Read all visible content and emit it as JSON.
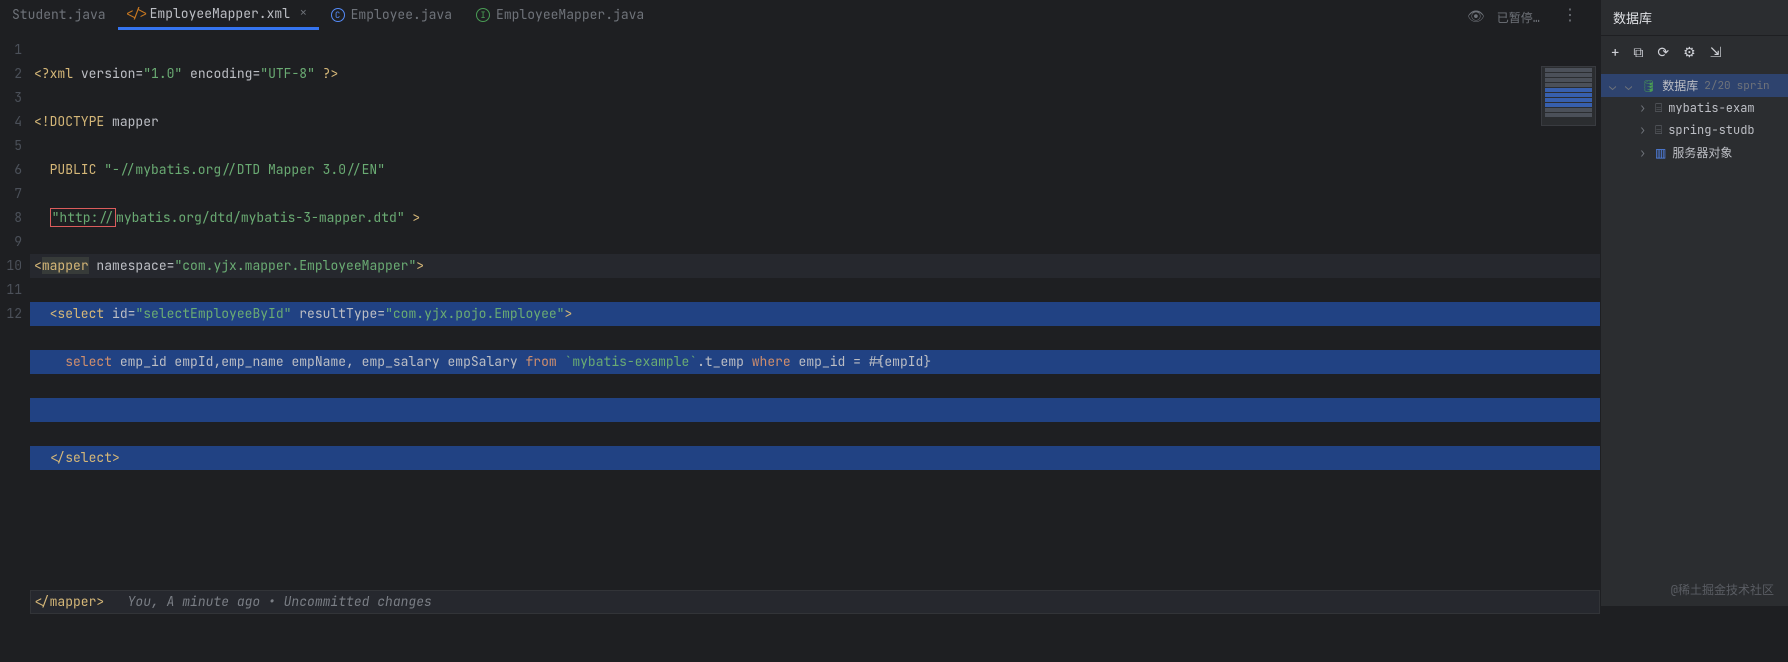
{
  "tabs": [
    {
      "label": "Student.java",
      "icon": "java",
      "active": false
    },
    {
      "label": "EmployeeMapper.xml",
      "icon": "xml",
      "active": true,
      "closable": true
    },
    {
      "label": "Employee.java",
      "icon": "class",
      "active": false
    },
    {
      "label": "EmployeeMapper.java",
      "icon": "interface",
      "active": false
    }
  ],
  "gutter": [
    "1",
    "2",
    "3",
    "4",
    "5",
    "6",
    "7",
    "8",
    "9",
    "10",
    "11",
    "12"
  ],
  "code": {
    "l1": {
      "a": "<?xml ",
      "b": "version",
      "c": "=",
      "d": "\"1.0\"",
      "e": " encoding",
      "f": "=",
      "g": "\"UTF-8\"",
      "h": " ?>"
    },
    "l2": {
      "a": "<!DOCTYPE ",
      "b": "mapper"
    },
    "l3": {
      "a": "  PUBLIC ",
      "b": "\"-//mybatis.org//DTD Mapper 3.0//EN\""
    },
    "l4": {
      "a": "  ",
      "b": "\"http://",
      "c": "mybatis.org/dtd/mybatis-3-mapper.dtd\"",
      "d": " >"
    },
    "l5": {
      "a": "<",
      "b": "mapper",
      "c": " namespace",
      "d": "=",
      "e": "\"com.yjx.mapper.EmployeeMapper\"",
      "f": ">"
    },
    "l6": {
      "a": "  <",
      "b": "select ",
      "c": "id",
      "d": "=",
      "e": "\"selectEmployeeById\"",
      "f": " resultType",
      "g": "=",
      "h": "\"com.yjx.pojo.Employee\"",
      "i": ">"
    },
    "l7": {
      "a": "    ",
      "b": "select ",
      "c": "emp_id ",
      "d": "empId",
      "e": ",",
      "f": "emp_name ",
      "g": "empName",
      "h": ", ",
      "i": "emp_salary ",
      "j": "empSalary ",
      "k": "from ",
      "l": "`mybatis-example`",
      "m": ".t_emp ",
      "n": "where ",
      "o": "emp_id ",
      "p": "= #{empId}"
    },
    "l8": "",
    "l9": {
      "a": "  </",
      "b": "select",
      "c": ">"
    },
    "l10": "",
    "l11": "",
    "l12": {
      "a": "</",
      "b": "mapper",
      "c": ">",
      "d": "   You, A minute ago • Uncommitted changes"
    }
  },
  "status": {
    "paused": "已暂停…"
  },
  "sidebar": {
    "title": "数据库",
    "root": {
      "label": "数据库",
      "count": "2/20",
      "tag": "sprin"
    },
    "items": [
      {
        "label": "mybatis-exam"
      },
      {
        "label": "spring-studb"
      },
      {
        "label": "服务器对象"
      }
    ]
  },
  "watermark": "@稀土掘金技术社区"
}
